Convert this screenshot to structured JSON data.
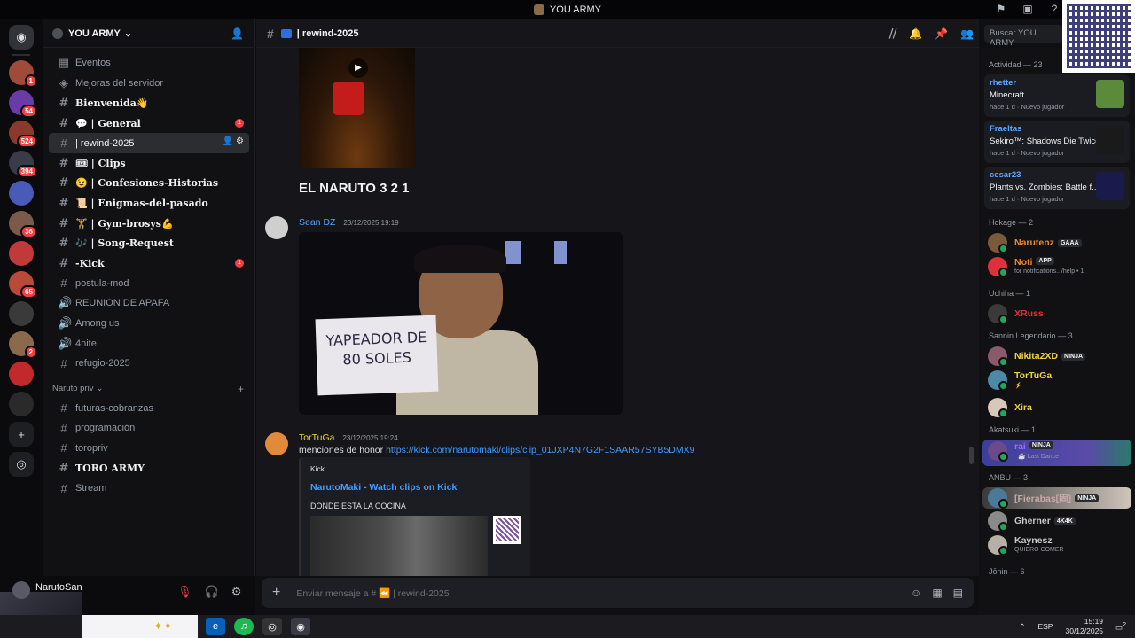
{
  "window_title": "YOU ARMY",
  "server": {
    "name": "YOU ARMY"
  },
  "guild_badges": [
    "1",
    "54",
    "524",
    "394",
    "",
    "36",
    "",
    "65",
    "",
    "2",
    "",
    ""
  ],
  "channels": [
    {
      "label": "Eventos",
      "kind": "event"
    },
    {
      "label": "Mejoras del servidor",
      "kind": "boost"
    },
    {
      "label": "Bienvenida👋",
      "kind": "text",
      "bold": true
    },
    {
      "label": "💬 | General",
      "kind": "text",
      "bold": true,
      "unread": "1"
    },
    {
      "label": "| rewind-2025",
      "kind": "text",
      "selected": true
    },
    {
      "label": "🎟 | Clips",
      "kind": "text",
      "bold": true
    },
    {
      "label": "😉 | Confesiones-Historias",
      "kind": "text",
      "bold": true
    },
    {
      "label": "📜 | Enigmas-del-pasado",
      "kind": "text",
      "bold": true
    },
    {
      "label": "🏋 | Gym-brosys💪",
      "kind": "text",
      "bold": true
    },
    {
      "label": "🎶 | Song-Request",
      "kind": "text",
      "bold": true
    },
    {
      "label": "-Kick",
      "kind": "text",
      "bold": true,
      "unread": "1"
    },
    {
      "label": "postula-mod",
      "kind": "text"
    },
    {
      "label": "REUNION DE APAFA",
      "kind": "voice"
    },
    {
      "label": "Among us",
      "kind": "voice"
    },
    {
      "label": "4nite",
      "kind": "voice"
    },
    {
      "label": "refugio-2025",
      "kind": "text"
    }
  ],
  "category": {
    "label": "Naruto priv"
  },
  "category_channels": [
    {
      "label": "futuras-cobranzas"
    },
    {
      "label": "programación"
    },
    {
      "label": "toropriv"
    },
    {
      "label": "TORO ARMY",
      "bold": true
    },
    {
      "label": "Stream"
    }
  ],
  "user": {
    "name": "NarutoSan"
  },
  "chat": {
    "channel": "| rewind-2025",
    "search_placeholder": "Buscar YOU ARMY",
    "caption": "EL NARUTO 3 2 1",
    "msg1": {
      "author": "Sean DZ",
      "time": "23/12/2025 19:19",
      "sign_line1": "YAPEADOR DE",
      "sign_line2": "80 SOLES"
    },
    "msg2": {
      "author": "TorTuGa",
      "time": "23/12/2025 19:24",
      "text": "menciones de honor",
      "link": "https://kick.com/narutomaki/clips/clip_01JXP4N7G2F1SAAR57SYB5DMX9",
      "embed": {
        "provider": "Kick",
        "title": "NarutoMaki - Watch clips on Kick",
        "description": "DONDE ESTA LA COCINA"
      }
    },
    "composer_placeholder": "Enviar mensaje a # ⏪ | rewind-2025"
  },
  "members": {
    "activity_title": "Actividad — 23",
    "activities": [
      {
        "name": "rhetter",
        "game": "Minecraft",
        "meta": "hace 1 d",
        "tag": "Nuevo jugador",
        "color": "#5b8a3a"
      },
      {
        "name": "Fraeltas",
        "game": "Sekiro™: Shadows Die Twice",
        "meta": "hace 1 d",
        "tag": "Nuevo jugador",
        "color": "#1a1a1a"
      },
      {
        "name": "cesar23",
        "game": "Plants vs. Zombies: Battle f...",
        "meta": "hace 1 d",
        "tag": "Nuevo jugador",
        "color": "#1a1b4a"
      }
    ],
    "groups": [
      {
        "title": "Hokage — 2",
        "items": [
          {
            "name": "Narutenz",
            "color": "#f0862a",
            "tag": "GAAA",
            "avatar": "#7a5a3a"
          },
          {
            "name": "Noti",
            "color": "#f0862a",
            "tag": "APP",
            "sub": "for notifications.. /help • 1",
            "avatar": "#e0303a"
          }
        ]
      },
      {
        "title": "Uchiha — 1",
        "items": [
          {
            "name": "XRuss",
            "color": "#e03030",
            "avatar": "#3a3a3a"
          }
        ]
      },
      {
        "title": "Sannin Legendario — 3",
        "items": [
          {
            "name": "Nikita2XD",
            "color": "#f0d23a",
            "tag": "NINJA",
            "avatar": "#8a5a6a"
          },
          {
            "name": "TorTuGa",
            "color": "#f0d23a",
            "sub": "⚡",
            "avatar": "#4a8aa8"
          },
          {
            "name": "Xira",
            "color": "#f0d23a",
            "avatar": "#d8c8b8"
          }
        ]
      },
      {
        "title": "Akatsuki — 1",
        "items": [
          {
            "name": "rai",
            "color": "#9a6aff",
            "tag": "NINJA",
            "sub": "☕ Last Dance",
            "avatar": "#6a4a8a",
            "hl": "hl"
          }
        ]
      },
      {
        "title": "ANBU — 3",
        "items": [
          {
            "name": "[Fierabas[固]",
            "color": "#c8a8a8",
            "tag": "NINJA",
            "avatar": "#4a7a9a",
            "hl": "hl2"
          },
          {
            "name": "Gherner",
            "color": "#c8c8c8",
            "tag": "4K4K",
            "avatar": "#8a8a8a"
          },
          {
            "name": "Kaynesz",
            "color": "#c8c8c8",
            "sub": "QUIERO COMER",
            "avatar": "#b8b0a8"
          }
        ]
      },
      {
        "title": "Jōnin — 6",
        "items": []
      }
    ]
  },
  "taskbar": {
    "lang": "ESP",
    "time": "15:19",
    "date": "30/12/2025",
    "notif": "2"
  }
}
